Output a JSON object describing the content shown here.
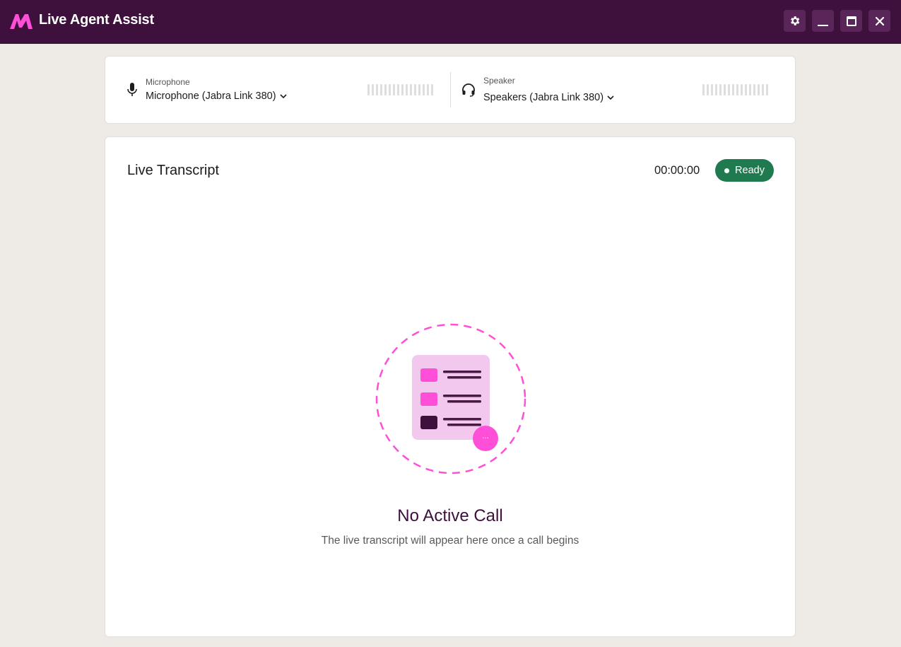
{
  "app": {
    "title": "Live Agent Assist",
    "logo_icon": "brand-m-logo",
    "colors": {
      "titlebar": "#3e113c",
      "accent": "#ff4fd8",
      "ready": "#1f7a4f"
    }
  },
  "window_controls": [
    {
      "name": "settings",
      "icon": "gear-icon"
    },
    {
      "name": "minimize",
      "icon": "minimize-icon"
    },
    {
      "name": "maximize",
      "icon": "maximize-icon"
    },
    {
      "name": "close",
      "icon": "close-icon"
    }
  ],
  "devices": {
    "microphone": {
      "label": "Microphone",
      "value": "Microphone (Jabra Link 380)",
      "icon": "microphone-icon"
    },
    "speaker": {
      "label": "Speaker",
      "value": "Speakers (Jabra Link 380)",
      "icon": "headset-icon"
    }
  },
  "transcript": {
    "title": "Live Transcript",
    "timer": "00:00:00",
    "status": "Ready",
    "empty_title": "No Active Call",
    "empty_subtitle": "The live transcript will appear here once a call begins",
    "empty_icon": "transcript-document-icon",
    "bubble_text": "···"
  }
}
